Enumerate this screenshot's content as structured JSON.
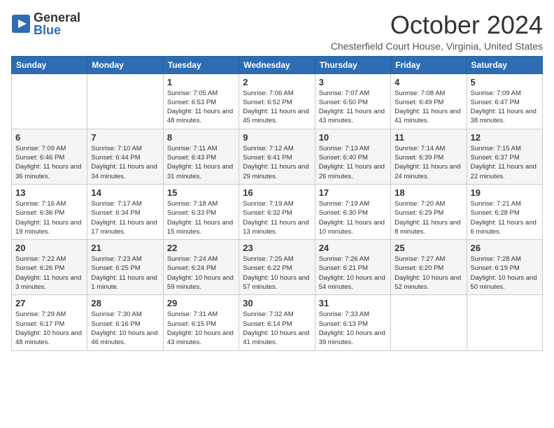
{
  "header": {
    "logo_general": "General",
    "logo_blue": "Blue",
    "title": "October 2024",
    "location": "Chesterfield Court House, Virginia, United States"
  },
  "days_of_week": [
    "Sunday",
    "Monday",
    "Tuesday",
    "Wednesday",
    "Thursday",
    "Friday",
    "Saturday"
  ],
  "weeks": [
    [
      {
        "day": "",
        "info": ""
      },
      {
        "day": "",
        "info": ""
      },
      {
        "day": "1",
        "info": "Sunrise: 7:05 AM\nSunset: 6:53 PM\nDaylight: 11 hours and 48 minutes."
      },
      {
        "day": "2",
        "info": "Sunrise: 7:06 AM\nSunset: 6:52 PM\nDaylight: 11 hours and 45 minutes."
      },
      {
        "day": "3",
        "info": "Sunrise: 7:07 AM\nSunset: 6:50 PM\nDaylight: 11 hours and 43 minutes."
      },
      {
        "day": "4",
        "info": "Sunrise: 7:08 AM\nSunset: 6:49 PM\nDaylight: 11 hours and 41 minutes."
      },
      {
        "day": "5",
        "info": "Sunrise: 7:09 AM\nSunset: 6:47 PM\nDaylight: 11 hours and 38 minutes."
      }
    ],
    [
      {
        "day": "6",
        "info": "Sunrise: 7:09 AM\nSunset: 6:46 PM\nDaylight: 11 hours and 36 minutes."
      },
      {
        "day": "7",
        "info": "Sunrise: 7:10 AM\nSunset: 6:44 PM\nDaylight: 11 hours and 34 minutes."
      },
      {
        "day": "8",
        "info": "Sunrise: 7:11 AM\nSunset: 6:43 PM\nDaylight: 11 hours and 31 minutes."
      },
      {
        "day": "9",
        "info": "Sunrise: 7:12 AM\nSunset: 6:41 PM\nDaylight: 11 hours and 29 minutes."
      },
      {
        "day": "10",
        "info": "Sunrise: 7:13 AM\nSunset: 6:40 PM\nDaylight: 11 hours and 26 minutes."
      },
      {
        "day": "11",
        "info": "Sunrise: 7:14 AM\nSunset: 6:39 PM\nDaylight: 11 hours and 24 minutes."
      },
      {
        "day": "12",
        "info": "Sunrise: 7:15 AM\nSunset: 6:37 PM\nDaylight: 11 hours and 22 minutes."
      }
    ],
    [
      {
        "day": "13",
        "info": "Sunrise: 7:16 AM\nSunset: 6:36 PM\nDaylight: 11 hours and 19 minutes."
      },
      {
        "day": "14",
        "info": "Sunrise: 7:17 AM\nSunset: 6:34 PM\nDaylight: 11 hours and 17 minutes."
      },
      {
        "day": "15",
        "info": "Sunrise: 7:18 AM\nSunset: 6:33 PM\nDaylight: 11 hours and 15 minutes."
      },
      {
        "day": "16",
        "info": "Sunrise: 7:19 AM\nSunset: 6:32 PM\nDaylight: 11 hours and 13 minutes."
      },
      {
        "day": "17",
        "info": "Sunrise: 7:19 AM\nSunset: 6:30 PM\nDaylight: 11 hours and 10 minutes."
      },
      {
        "day": "18",
        "info": "Sunrise: 7:20 AM\nSunset: 6:29 PM\nDaylight: 11 hours and 8 minutes."
      },
      {
        "day": "19",
        "info": "Sunrise: 7:21 AM\nSunset: 6:28 PM\nDaylight: 11 hours and 6 minutes."
      }
    ],
    [
      {
        "day": "20",
        "info": "Sunrise: 7:22 AM\nSunset: 6:26 PM\nDaylight: 11 hours and 3 minutes."
      },
      {
        "day": "21",
        "info": "Sunrise: 7:23 AM\nSunset: 6:25 PM\nDaylight: 11 hours and 1 minute."
      },
      {
        "day": "22",
        "info": "Sunrise: 7:24 AM\nSunset: 6:24 PM\nDaylight: 10 hours and 59 minutes."
      },
      {
        "day": "23",
        "info": "Sunrise: 7:25 AM\nSunset: 6:22 PM\nDaylight: 10 hours and 57 minutes."
      },
      {
        "day": "24",
        "info": "Sunrise: 7:26 AM\nSunset: 6:21 PM\nDaylight: 10 hours and 54 minutes."
      },
      {
        "day": "25",
        "info": "Sunrise: 7:27 AM\nSunset: 6:20 PM\nDaylight: 10 hours and 52 minutes."
      },
      {
        "day": "26",
        "info": "Sunrise: 7:28 AM\nSunset: 6:19 PM\nDaylight: 10 hours and 50 minutes."
      }
    ],
    [
      {
        "day": "27",
        "info": "Sunrise: 7:29 AM\nSunset: 6:17 PM\nDaylight: 10 hours and 48 minutes."
      },
      {
        "day": "28",
        "info": "Sunrise: 7:30 AM\nSunset: 6:16 PM\nDaylight: 10 hours and 46 minutes."
      },
      {
        "day": "29",
        "info": "Sunrise: 7:31 AM\nSunset: 6:15 PM\nDaylight: 10 hours and 43 minutes."
      },
      {
        "day": "30",
        "info": "Sunrise: 7:32 AM\nSunset: 6:14 PM\nDaylight: 10 hours and 41 minutes."
      },
      {
        "day": "31",
        "info": "Sunrise: 7:33 AM\nSunset: 6:13 PM\nDaylight: 10 hours and 39 minutes."
      },
      {
        "day": "",
        "info": ""
      },
      {
        "day": "",
        "info": ""
      }
    ]
  ]
}
